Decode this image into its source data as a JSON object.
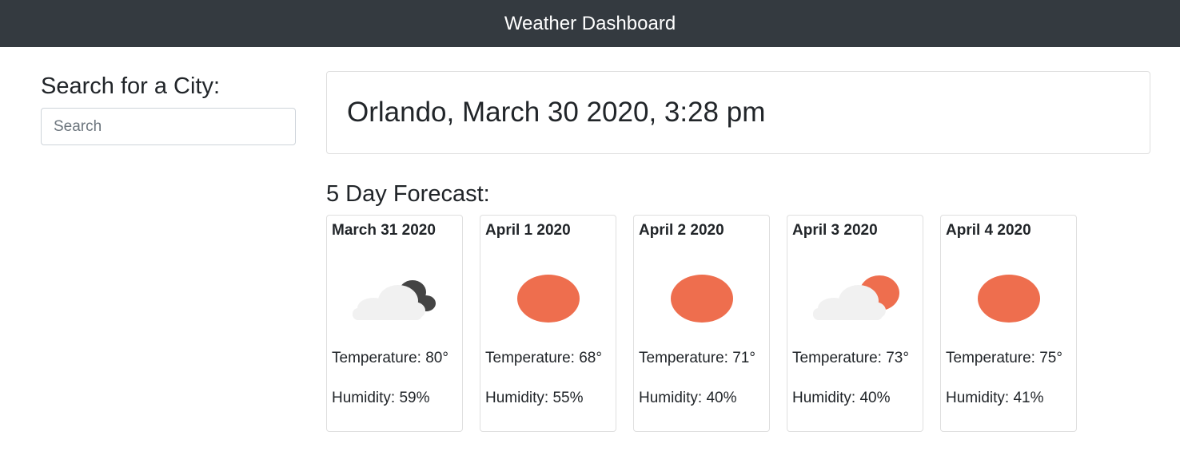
{
  "header": {
    "title": "Weather Dashboard"
  },
  "sidebar": {
    "heading": "Search for a City:",
    "search": {
      "placeholder": "Search",
      "value": ""
    }
  },
  "current": {
    "title": "Orlando, March 30 2020, 3:28 pm"
  },
  "forecast": {
    "heading": "5 Day Forecast:",
    "days": [
      {
        "date": "March 31 2020",
        "icon": "cloudy-night-icon",
        "temperature": "Temperature: 80°",
        "humidity": "Humidity: 59%"
      },
      {
        "date": "April 1 2020",
        "icon": "sun-icon",
        "temperature": "Temperature: 68°",
        "humidity": "Humidity: 55%"
      },
      {
        "date": "April 2 2020",
        "icon": "sun-icon",
        "temperature": "Temperature: 71°",
        "humidity": "Humidity: 40%"
      },
      {
        "date": "April 3 2020",
        "icon": "partly-cloudy-icon",
        "temperature": "Temperature: 73°",
        "humidity": "Humidity: 40%"
      },
      {
        "date": "April 4 2020",
        "icon": "sun-icon",
        "temperature": "Temperature: 75°",
        "humidity": "Humidity: 41%"
      }
    ]
  },
  "colors": {
    "navbar": "#343a40",
    "sun": "#ee6e4e",
    "cloud": "#f1f1f1",
    "dark_cloud": "#444444"
  }
}
